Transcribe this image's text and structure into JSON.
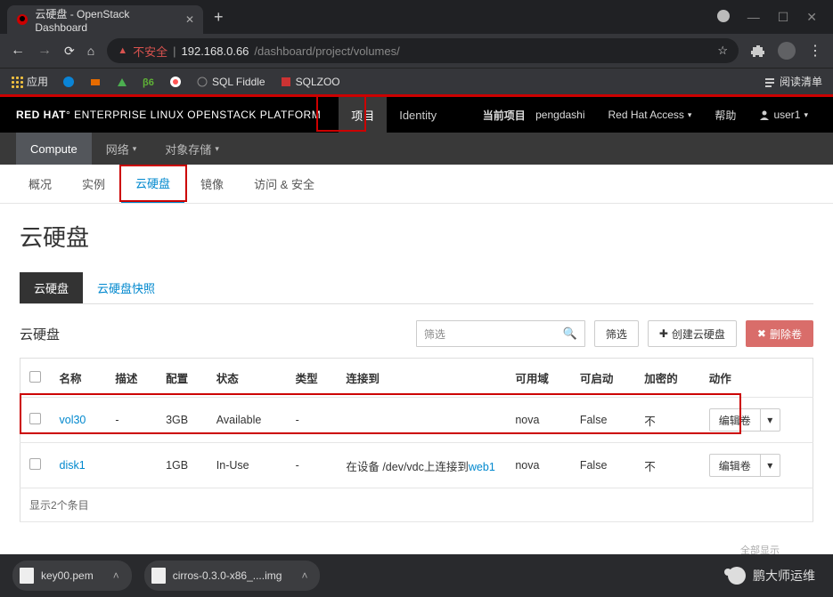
{
  "browser": {
    "tab_title": "云硬盘 - OpenStack Dashboard",
    "plus": "+",
    "win": {
      "min": "—",
      "max": "☐",
      "close": "✕"
    },
    "addr": {
      "insecure": "不安全",
      "host": "192.168.0.66",
      "path": "/dashboard/project/volumes/"
    },
    "bookmarks": {
      "apps": "应用",
      "items": [
        "SQL Fiddle",
        "SQLZOO"
      ],
      "readlist": "阅读清单"
    }
  },
  "header": {
    "brand_a": "RED HAT",
    "brand_b": "ENTERPRISE LINUX OPENSTACK PLATFORM",
    "menu": [
      {
        "label": "项目"
      },
      {
        "label": "Identity"
      }
    ],
    "project_lbl": "当前项目",
    "project_val": "pengdashi",
    "access": "Red Hat Access",
    "help": "帮助",
    "user": "user1"
  },
  "navdark": [
    {
      "label": "Compute"
    },
    {
      "label": "网络"
    },
    {
      "label": "对象存储"
    }
  ],
  "subtabs": [
    "概况",
    "实例",
    "云硬盘",
    "镜像",
    "访问 & 安全"
  ],
  "page": {
    "title": "云硬盘"
  },
  "minitabs": [
    "云硬盘",
    "云硬盘快照"
  ],
  "toolbar": {
    "section": "云硬盘",
    "filter_ph": "筛选",
    "filter_btn": "筛选",
    "create": "创建云硬盘",
    "delete": "删除卷"
  },
  "table": {
    "cols": [
      "名称",
      "描述",
      "配置",
      "状态",
      "类型",
      "连接到",
      "可用域",
      "可启动",
      "加密的",
      "动作"
    ],
    "rows": [
      {
        "name": "vol30",
        "desc": "-",
        "size": "3GB",
        "status": "Available",
        "type": "-",
        "attach": "",
        "zone": "nova",
        "boot": "False",
        "enc": "不",
        "action": "编辑卷"
      },
      {
        "name": "disk1",
        "desc": "",
        "size": "1GB",
        "status": "In-Use",
        "type": "-",
        "attach_pre": "在设备 /dev/vdc上连接到",
        "attach_link": "web1",
        "zone": "nova",
        "boot": "False",
        "enc": "不",
        "action": "编辑卷"
      }
    ],
    "footer": "显示2个条目"
  },
  "downloads": [
    {
      "name": "key00.pem"
    },
    {
      "name": "cirros-0.3.0-x86_....img"
    }
  ],
  "allshow": "全部显示",
  "watermark": "鹏大师运维"
}
